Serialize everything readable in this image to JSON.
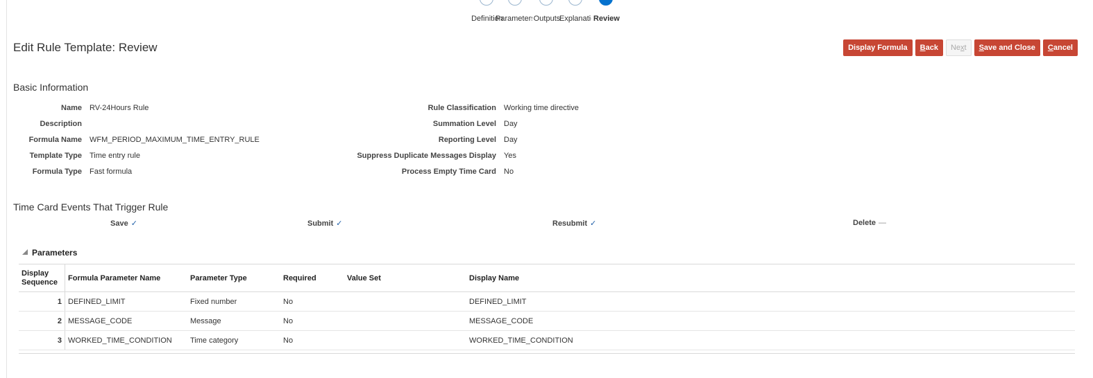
{
  "train": {
    "stops": [
      {
        "label": "Definition",
        "icon": "check-icon",
        "current": false
      },
      {
        "label": "Parameters",
        "icon": "check-icon",
        "current": false
      },
      {
        "label": "Outputs",
        "icon": "check-icon",
        "current": false
      },
      {
        "label": "Explanation",
        "icon": "check-icon",
        "current": false
      },
      {
        "label": "Review",
        "icon": "5",
        "current": true
      }
    ]
  },
  "page": {
    "title": "Edit Rule Template: Review"
  },
  "toolbar": {
    "display_formula": "Display Formula",
    "back": "Back",
    "next": "Next",
    "save_close": "Save and Close",
    "cancel": "Cancel"
  },
  "basic": {
    "title": "Basic Information",
    "left": [
      {
        "label": "Name",
        "value": "RV-24Hours Rule"
      },
      {
        "label": "Description",
        "value": ""
      },
      {
        "label": "Formula Name",
        "value": "WFM_PERIOD_MAXIMUM_TIME_ENTRY_RULE"
      },
      {
        "label": "Template Type",
        "value": "Time entry rule"
      },
      {
        "label": "Formula Type",
        "value": "Fast formula"
      }
    ],
    "right": [
      {
        "label": "Rule Classification",
        "value": "Working time directive"
      },
      {
        "label": "Summation Level",
        "value": "Day"
      },
      {
        "label": "Reporting Level",
        "value": "Day"
      },
      {
        "label": "Suppress Duplicate Messages Display",
        "value": "Yes"
      },
      {
        "label": "Process Empty Time Card",
        "value": "No"
      }
    ]
  },
  "events": {
    "title": "Time Card Events That Trigger Rule",
    "items": [
      {
        "label": "Save",
        "mark": "✓"
      },
      {
        "label": "Submit",
        "mark": "✓"
      },
      {
        "label": "Resubmit",
        "mark": "✓"
      },
      {
        "label": "Delete",
        "mark": "—"
      }
    ]
  },
  "parameters": {
    "title": "Parameters",
    "columns": [
      "Display Sequence",
      "Formula Parameter Name",
      "Parameter Type",
      "Required",
      "Value Set",
      "Display Name"
    ],
    "rows": [
      [
        "1",
        "DEFINED_LIMIT",
        "Fixed number",
        "No",
        "",
        "DEFINED_LIMIT"
      ],
      [
        "2",
        "MESSAGE_CODE",
        "Message",
        "No",
        "",
        "MESSAGE_CODE"
      ],
      [
        "3",
        "WORKED_TIME_CONDITION",
        "Time category",
        "No",
        "",
        "WORKED_TIME_CONDITION"
      ]
    ]
  },
  "colors": {
    "accent": "#c74634",
    "train_current": "#0572ce"
  }
}
